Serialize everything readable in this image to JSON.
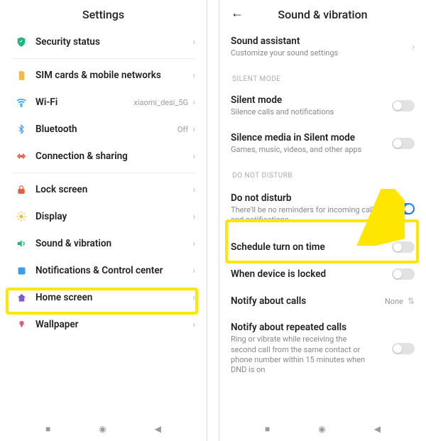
{
  "left": {
    "title": "Settings",
    "items": {
      "security": {
        "label": "Security status"
      },
      "sim": {
        "label": "SIM cards & mobile networks"
      },
      "wifi": {
        "label": "Wi-Fi",
        "value": "xiaomi_desi_5G"
      },
      "bt": {
        "label": "Bluetooth",
        "value": "Off"
      },
      "share": {
        "label": "Connection & sharing"
      },
      "lock": {
        "label": "Lock screen"
      },
      "display": {
        "label": "Display"
      },
      "sound": {
        "label": "Sound & vibration"
      },
      "notif": {
        "label": "Notifications & Control center"
      },
      "home": {
        "label": "Home screen"
      },
      "wall": {
        "label": "Wallpaper"
      }
    }
  },
  "right": {
    "title": "Sound & vibration",
    "assistant": {
      "label": "Sound assistant",
      "sub": "Customize your sound settings"
    },
    "sections": {
      "silent": "Silent mode",
      "dnd": "Do not disturb"
    },
    "silent_mode": {
      "label": "Silent mode",
      "sub": "Silence calls and notifications"
    },
    "silence_media": {
      "label": "Silence media in Silent mode",
      "sub": "Games, music, videos, and other apps"
    },
    "dnd": {
      "label": "Do not disturb",
      "sub": "There'll be no reminders for incoming calls and notifications"
    },
    "schedule": {
      "label": "Schedule turn on time"
    },
    "locked": {
      "label": "When device is locked"
    },
    "notify_calls": {
      "label": "Notify about calls",
      "value": "None"
    },
    "repeated": {
      "label": "Notify about repeated calls",
      "sub": "Ring or vibrate while receiving the second call from the same contact or phone number within 15 minutes when DND is on"
    }
  }
}
